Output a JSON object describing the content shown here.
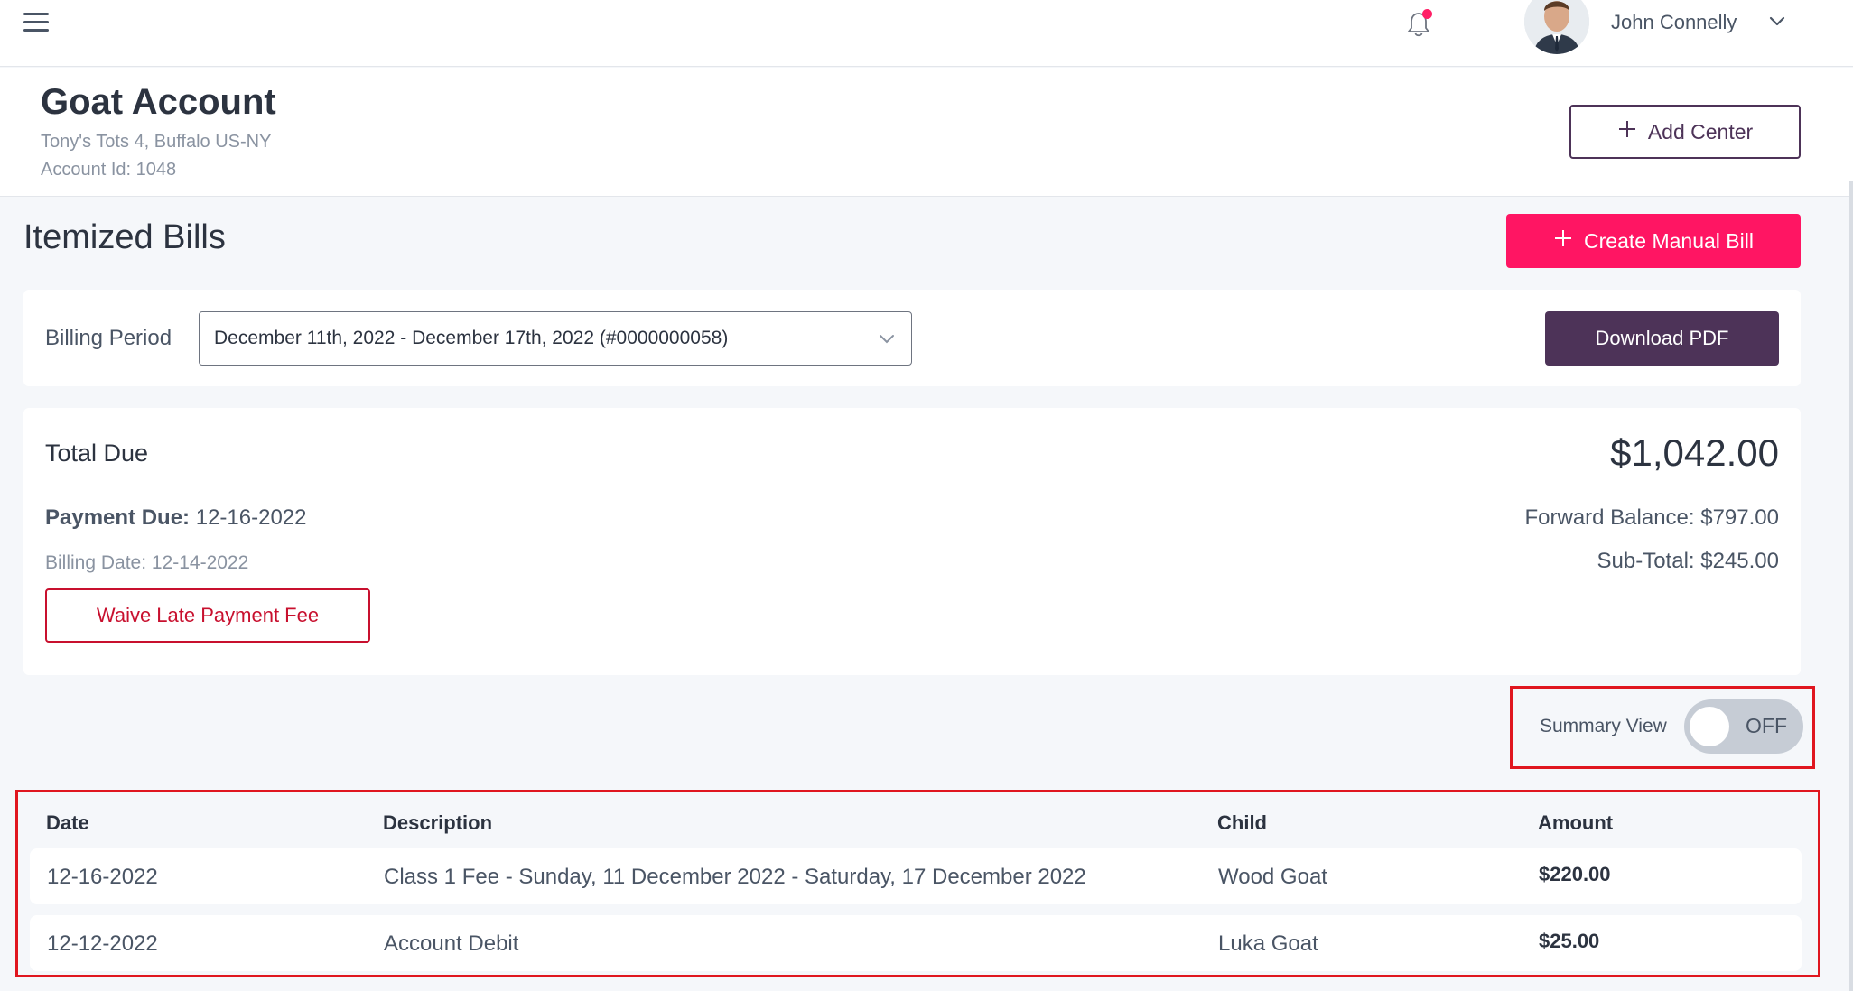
{
  "topbar": {
    "user_name": "John Connelly",
    "notification_unread": true
  },
  "account": {
    "title": "Goat Account",
    "location": "Tony's Tots 4, Buffalo US-NY",
    "account_id": "Account Id: 1048",
    "add_center_label": "Add Center"
  },
  "itemized": {
    "title": "Itemized Bills",
    "create_bill_label": "Create Manual Bill"
  },
  "billing_period": {
    "label": "Billing Period",
    "selected": "December 11th, 2022 - December 17th, 2022 (#0000000058)",
    "download_label": "Download PDF"
  },
  "totals": {
    "total_due_label": "Total Due",
    "total_due_amount": "$1,042.00",
    "payment_due_label": "Payment Due:",
    "payment_due_date": "12-16-2022",
    "billing_date": "Billing Date: 12-14-2022",
    "waive_label": "Waive Late Payment Fee",
    "forward_balance": "Forward Balance: $797.00",
    "sub_total": "Sub-Total: $245.00"
  },
  "summary_view": {
    "label": "Summary View",
    "state": "OFF"
  },
  "table": {
    "headers": {
      "date": "Date",
      "description": "Description",
      "child": "Child",
      "amount": "Amount"
    },
    "rows": [
      {
        "date": "12-16-2022",
        "description": "Class 1 Fee - Sunday, 11 December 2022 - Saturday, 17 December 2022",
        "child": "Wood Goat",
        "amount": "$220.00"
      },
      {
        "date": "12-12-2022",
        "description": "Account Debit",
        "child": "Luka Goat",
        "amount": "$25.00"
      }
    ]
  },
  "colors": {
    "brand_purple": "#4d3358",
    "brand_pink": "#ff1563",
    "danger_red": "#c8102e",
    "highlight_red": "#e0161f"
  }
}
